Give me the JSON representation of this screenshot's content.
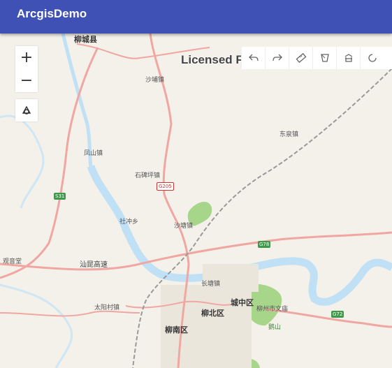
{
  "app": {
    "title": "ArcgisDemo"
  },
  "map": {
    "watermark": "Licensed F",
    "zoom_in_label": "+",
    "zoom_out_label": "−",
    "labels": {
      "liucheng": "柳城县",
      "shabu": "沙埔镇",
      "dongquan": "东泉镇",
      "fengshan": "凤山镇",
      "shibeiping": "石碑坪镇",
      "shechong": "社冲乡",
      "shatang": "沙塘镇",
      "guanyintang": "观音堂",
      "shantao": "汕昆高速",
      "changtang": "长塘镇",
      "taiyangcun": "太阳村镇",
      "liubei": "柳北区",
      "chengzhong": "城中区",
      "liunan": "柳南区",
      "wenmiao": "柳州市文庙",
      "park": "鹅山"
    },
    "shields": {
      "s31": "S31",
      "g205": "G205",
      "g78": "G78",
      "g72": "G72"
    }
  },
  "toolbar": {
    "items": [
      {
        "icon": "undo-icon"
      },
      {
        "icon": "redo-icon"
      },
      {
        "icon": "measure-icon"
      },
      {
        "icon": "polygon-icon"
      },
      {
        "icon": "basemap-icon"
      },
      {
        "icon": "refresh-icon"
      }
    ]
  },
  "colors": {
    "appbar": "#3f51b5",
    "map_background": "#f3f1ea",
    "water": "#bfe0f5",
    "road": "#f0a7a1",
    "green": "#a7d68a"
  }
}
